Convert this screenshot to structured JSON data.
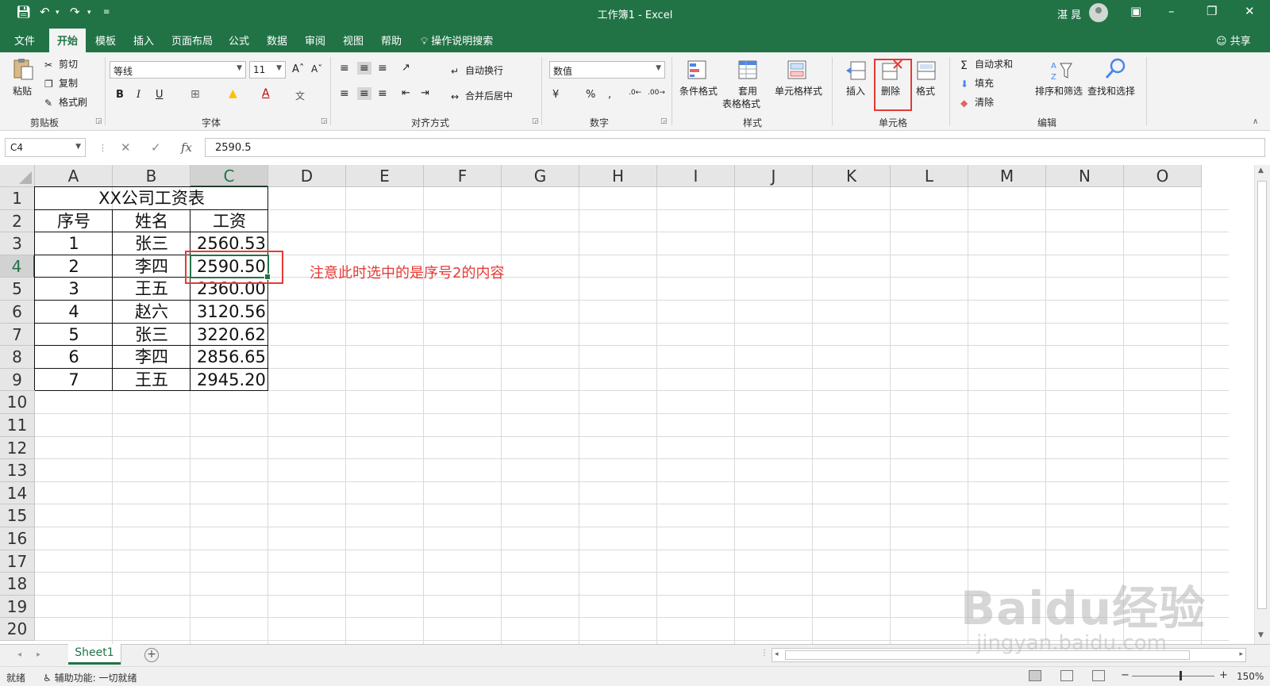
{
  "app": {
    "title": "工作簿1  -  Excel",
    "user": "湛 晁"
  },
  "tabs": [
    "文件",
    "开始",
    "模板",
    "插入",
    "页面布局",
    "公式",
    "数据",
    "审阅",
    "视图",
    "帮助"
  ],
  "tell_me": "操作说明搜索",
  "share": "共享",
  "ribbon": {
    "clipboard": {
      "label": "剪贴板",
      "paste": "粘贴",
      "cut": "剪切",
      "copy": "复制",
      "format_painter": "格式刷"
    },
    "font": {
      "label": "字体",
      "font_name": "等线",
      "font_size": "11"
    },
    "alignment": {
      "label": "对齐方式",
      "wrap": "自动换行",
      "merge": "合并后居中"
    },
    "number": {
      "label": "数字",
      "format": "数值"
    },
    "styles": {
      "label": "样式",
      "conditional": "条件格式",
      "table_1": "套用",
      "table_2": "表格格式",
      "cell_styles": "单元格样式"
    },
    "cells": {
      "label": "单元格",
      "insert": "插入",
      "delete": "删除",
      "format": "格式"
    },
    "editing": {
      "label": "编辑",
      "autosum": "自动求和",
      "fill": "填充",
      "clear": "清除",
      "sort": "排序和筛选",
      "find": "查找和选择"
    }
  },
  "formula_bar": {
    "name_box": "C4",
    "formula": "2590.5",
    "fx": "fx"
  },
  "columns": [
    "A",
    "B",
    "C",
    "D",
    "E",
    "F",
    "G",
    "H",
    "I",
    "J",
    "K",
    "L",
    "M",
    "N",
    "O"
  ],
  "rows": [
    "1",
    "2",
    "3",
    "4",
    "5",
    "6",
    "7",
    "8",
    "9",
    "10",
    "11",
    "12",
    "13",
    "14",
    "15",
    "16",
    "17",
    "18",
    "19",
    "20"
  ],
  "table": {
    "title": "XX公司工资表",
    "headers": [
      "序号",
      "姓名",
      "工资"
    ],
    "rows": [
      [
        "1",
        "张三",
        "2560.53"
      ],
      [
        "2",
        "李四",
        "2590.50"
      ],
      [
        "3",
        "王五",
        "2360.00"
      ],
      [
        "4",
        "赵六",
        "3120.56"
      ],
      [
        "5",
        "张三",
        "3220.62"
      ],
      [
        "6",
        "李四",
        "2856.65"
      ],
      [
        "7",
        "王五",
        "2945.20"
      ]
    ]
  },
  "annotation": "注意此时选中的是序号2的内容",
  "sheet_tab": "Sheet1",
  "status": {
    "ready": "就绪",
    "accessibility": "辅助功能: 一切就绪",
    "zoom": "150%"
  },
  "watermark": {
    "brand": "Baidu经验",
    "url": "jingyan.baidu.com"
  },
  "colors": {
    "excel_green": "#217346",
    "annotation_red": "#e53935"
  }
}
